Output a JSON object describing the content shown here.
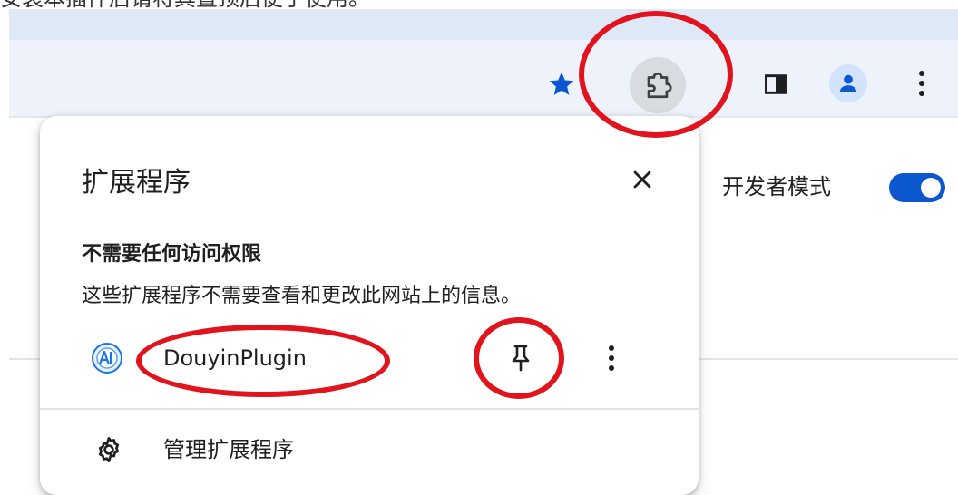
{
  "caption": "安装本插件后请将其置顶后便于使用。",
  "toolbar": {
    "star_icon": "bookmark-star-icon",
    "extensions_icon": "puzzle-icon",
    "side_panel_icon": "side-panel-icon",
    "profile_icon": "profile-icon",
    "menu_icon": "kebab-menu-icon"
  },
  "page": {
    "dev_mode_label": "开发者模式",
    "dev_mode_on": true
  },
  "popup": {
    "title": "扩展程序",
    "close_icon": "close-icon",
    "section_title": "不需要任何访问权限",
    "section_desc": "这些扩展程序不需要查看和更改此网站上的信息。",
    "extension": {
      "name": "DouyinPlugin",
      "logo_icon": "douyinplugin-logo-icon",
      "pin_icon": "pin-icon",
      "more_icon": "kebab-menu-icon"
    },
    "manage_label": "管理扩展程序",
    "manage_icon": "gear-icon"
  },
  "colors": {
    "accent": "#0b57d0",
    "annotation_red": "#e1141e",
    "toolbar_bg": "#eef2fa"
  }
}
